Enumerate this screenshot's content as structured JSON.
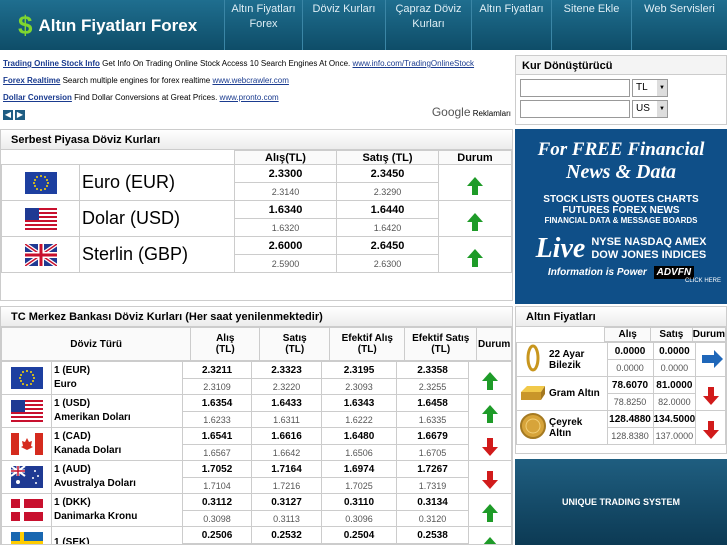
{
  "site": {
    "dollar": "$",
    "name": "Altın Fiyatları Forex"
  },
  "nav": [
    {
      "label": "Altın Fiyatları\nForex"
    },
    {
      "label": "Döviz Kurları"
    },
    {
      "label": "Çapraz Döviz\nKurları"
    },
    {
      "label": "Altın Fiyatları"
    },
    {
      "label": "Sitene Ekle"
    },
    {
      "label": "Web Servisleri"
    }
  ],
  "ads": [
    {
      "title": "Trading Online Stock Info",
      "text": "Get Info On Trading Online Stock Access 10 Search Engines At Once.",
      "url": "www.info.com/TradingOnlineStock"
    },
    {
      "title": "Forex Realtime",
      "text": "Search multiple engines for forex realtime",
      "url": "www.webcrawler.com"
    },
    {
      "title": "Dollar Conversion",
      "text": "Find Dollar Conversions at Great Prices.",
      "url": "www.pronto.com"
    }
  ],
  "ads_footer": {
    "google": "Google",
    "label": "Reklamları"
  },
  "converter": {
    "title": "Kur Dönüştürücü",
    "from": "TL",
    "to": "US"
  },
  "free_market": {
    "title": "Serbest Piyasa Döviz Kurları",
    "headers": {
      "buy": "Alış(TL)",
      "sell": "Satış (TL)",
      "status": "Durum"
    },
    "rows": [
      {
        "name": "Euro (EUR)",
        "buy": "2.3300",
        "sell": "2.3450",
        "buy_prev": "2.3140",
        "sell_prev": "2.3290",
        "trend": "up"
      },
      {
        "name": "Dolar (USD)",
        "buy": "1.6340",
        "sell": "1.6440",
        "buy_prev": "1.6320",
        "sell_prev": "1.6420",
        "trend": "up"
      },
      {
        "name": "Sterlin (GBP)",
        "buy": "2.6000",
        "sell": "2.6450",
        "buy_prev": "2.5900",
        "sell_prev": "2.6300",
        "trend": "up"
      }
    ]
  },
  "central_bank": {
    "title": "TC Merkez Bankası Döviz Kurları (Her saat yenilenmektedir)",
    "headers": {
      "type": "Döviz Türü",
      "buy": "Alış\n(TL)",
      "sell": "Satış\n(TL)",
      "eff_buy": "Efektif Alış\n(TL)",
      "eff_sell": "Efektif Satış\n(TL)",
      "status": "Durum"
    },
    "rows": [
      {
        "code": "1 (EUR)",
        "name": "Euro",
        "buy": "2.3211",
        "sell": "2.3323",
        "eff_buy": "2.3195",
        "eff_sell": "2.3358",
        "p_buy": "2.3109",
        "p_sell": "2.3220",
        "p_eff_buy": "2.3093",
        "p_eff_sell": "2.3255",
        "trend": "up"
      },
      {
        "code": "1 (USD)",
        "name": "Amerikan Doları",
        "buy": "1.6354",
        "sell": "1.6433",
        "eff_buy": "1.6343",
        "eff_sell": "1.6458",
        "p_buy": "1.6233",
        "p_sell": "1.6311",
        "p_eff_buy": "1.6222",
        "p_eff_sell": "1.6335",
        "trend": "up"
      },
      {
        "code": "1 (CAD)",
        "name": "Kanada Doları",
        "buy": "1.6541",
        "sell": "1.6616",
        "eff_buy": "1.6480",
        "eff_sell": "1.6679",
        "p_buy": "1.6567",
        "p_sell": "1.6642",
        "p_eff_buy": "1.6506",
        "p_eff_sell": "1.6705",
        "trend": "down"
      },
      {
        "code": "1 (AUD)",
        "name": "Avustralya Doları",
        "buy": "1.7052",
        "sell": "1.7164",
        "eff_buy": "1.6974",
        "eff_sell": "1.7267",
        "p_buy": "1.7104",
        "p_sell": "1.7216",
        "p_eff_buy": "1.7025",
        "p_eff_sell": "1.7319",
        "trend": "down"
      },
      {
        "code": "1 (DKK)",
        "name": "Danimarka Kronu",
        "buy": "0.3112",
        "sell": "0.3127",
        "eff_buy": "0.3110",
        "eff_sell": "0.3134",
        "p_buy": "0.3098",
        "p_sell": "0.3113",
        "p_eff_buy": "0.3096",
        "p_eff_sell": "0.3120",
        "trend": "up"
      },
      {
        "code": "1 (SEK)",
        "name": "",
        "buy": "0.2506",
        "sell": "0.2532",
        "eff_buy": "0.2504",
        "eff_sell": "0.2538",
        "trend": "up"
      }
    ]
  },
  "ad1": {
    "l1": "For FREE Financial",
    "l2": "News & Data",
    "l3": "STOCK LISTS  QUOTES  CHARTS",
    "l4": "FUTURES  FOREX  NEWS",
    "l5": "FINANCIAL DATA & MESSAGE BOARDS",
    "live": "Live",
    "ex1": "NYSE NASDAQ AMEX",
    "ex2": "DOW JONES INDICES",
    "tag": "Information is Power",
    "brand": "ADVFN",
    "click": "CLICK HERE"
  },
  "gold": {
    "title": "Altın Fiyatları",
    "headers": {
      "buy": "Alış",
      "sell": "Satış",
      "status": "Durum"
    },
    "rows": [
      {
        "name": "22 Ayar Bilezik",
        "buy": "0.0000",
        "sell": "0.0000",
        "buy_prev": "0.0000",
        "sell_prev": "0.0000",
        "trend": "right"
      },
      {
        "name": "Gram Altın",
        "buy": "78.6070",
        "sell": "81.0000",
        "buy_prev": "78.8250",
        "sell_prev": "82.0000",
        "trend": "down"
      },
      {
        "name": "Çeyrek Altın",
        "buy": "128.4880",
        "sell": "134.5000",
        "buy_prev": "128.8380",
        "sell_prev": "137.0000",
        "trend": "down"
      }
    ]
  },
  "ad2": {
    "text": "UNIQUE TRADING SYSTEM"
  }
}
